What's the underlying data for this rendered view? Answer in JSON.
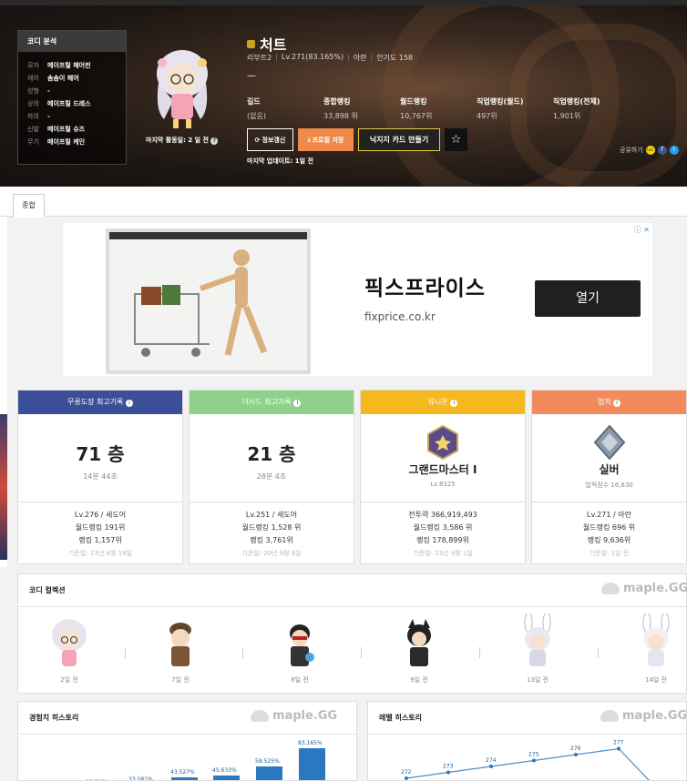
{
  "coordi": {
    "title": "코디 분석",
    "rows": [
      {
        "k": "모자",
        "v": "메이프릴 헤어핀"
      },
      {
        "k": "헤어",
        "v": "솜솜이 헤어"
      },
      {
        "k": "성형",
        "v": "-"
      },
      {
        "k": "상의",
        "v": "메이프릴 드레스"
      },
      {
        "k": "하의",
        "v": "-"
      },
      {
        "k": "신발",
        "v": "메이프릴 슈즈"
      },
      {
        "k": "무기",
        "v": "메이프릴 케인"
      }
    ]
  },
  "character": {
    "name": "처트",
    "server": "리부트2",
    "level": "Lv.271(83.165%)",
    "job": "아란",
    "popularity": "인기도 158",
    "dash": "—",
    "last_activity": "마지막 활동일: 2 일 전",
    "last_update": "마지막 업데이트: 1일 전"
  },
  "stats": [
    {
      "label": "길드",
      "value": "(없음)"
    },
    {
      "label": "종합랭킹",
      "value": "33,898 위"
    },
    {
      "label": "월드랭킹",
      "value": "10,767위"
    },
    {
      "label": "직업랭킹(월드)",
      "value": "497위"
    },
    {
      "label": "직업랭킹(전체)",
      "value": "1,901위"
    }
  ],
  "buttons": {
    "refresh": "정보갱신",
    "save": "프로필 저장",
    "card": "닉지지 카드 만들기",
    "star": "☆"
  },
  "share": {
    "label": "공유하기",
    "kakao": "talk",
    "fb": "f",
    "tw": "t"
  },
  "tabs": [
    {
      "label": "종합"
    }
  ],
  "ad": {
    "title": "픽스프라이스",
    "url": "fixprice.co.kr",
    "open": "열기",
    "choice": "ⓘ ✕"
  },
  "cards": [
    {
      "header": "무릉도장 최고기록",
      "color": "#3b4f99",
      "big": "71 층",
      "sub": "14분 44초",
      "foot1": "Lv.276 / 세도어",
      "foot2": "월드랭킹 191위",
      "foot3": "랭킹 1,157위",
      "ts": "기준일: 23년 8월 19일"
    },
    {
      "header": "더시드 최고기록",
      "color": "#8fd18b",
      "big": "21 층",
      "sub": "28분 4초",
      "foot1": "Lv.251 / 세도어",
      "foot2": "월드랭킹 1,528 위",
      "foot3": "랭킹 3,761위",
      "ts": "기준일: 20년 9월 6일"
    },
    {
      "header": "유니온",
      "color": "#f5b91f",
      "big": "그랜드마스터 I",
      "sub": "Lv.8325",
      "foot1": "전투력 366,919,493",
      "foot2": "월드랭킹 3,586 위",
      "foot3": "랭킹 178,899위",
      "ts": "기준일: 23년 9월 1일"
    },
    {
      "header": "업적",
      "color": "#f28a5c",
      "big": "실버",
      "sub": "업적점수 16,830",
      "foot1": "Lv.271 / 아란",
      "foot2": "월드랭킹 696 위",
      "foot3": "랭킹 9,636위",
      "ts": "기준일: 1일 전"
    }
  ],
  "collection": {
    "title": "코디 컬렉션",
    "brand": "maple.GG",
    "items": [
      {
        "ts": "2일 전"
      },
      {
        "ts": "7일 전"
      },
      {
        "ts": "8일 전"
      },
      {
        "ts": "9일 전"
      },
      {
        "ts": "13일 전"
      },
      {
        "ts": "14일 전"
      }
    ]
  },
  "exp_history": {
    "title": "경험치 히스토리",
    "brand": "maple.GG",
    "chart_data": {
      "type": "bar",
      "values": [
        30.502,
        33.581,
        43.527,
        45.633,
        58.525,
        83.165
      ],
      "labels": [
        "30.502%",
        "33.581%",
        "43.527%",
        "45.633%",
        "58.525%",
        "83.165%"
      ]
    }
  },
  "level_history": {
    "title": "레벨 히스토리",
    "brand": "maple.GG",
    "chart_data": {
      "type": "line",
      "values": [
        272,
        273,
        274,
        275,
        276,
        277
      ],
      "labels": [
        "272",
        "273",
        "274",
        "275",
        "276",
        "277"
      ]
    }
  }
}
